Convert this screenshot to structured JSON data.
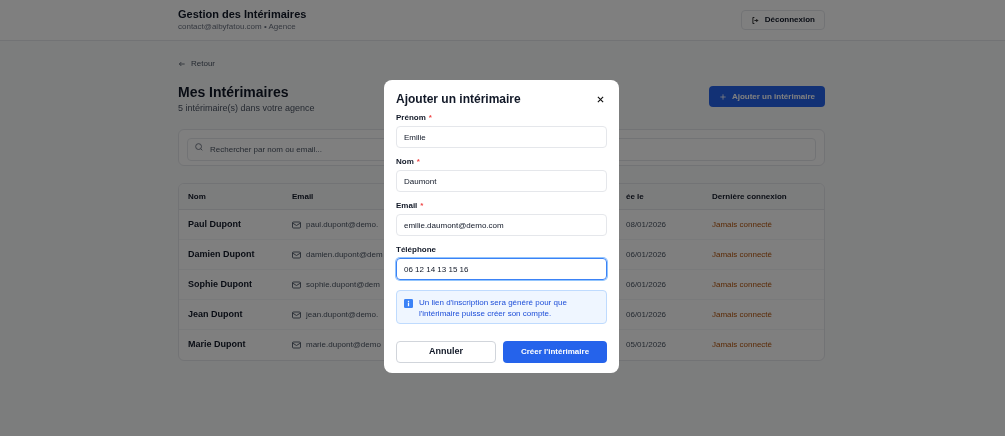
{
  "header": {
    "title": "Gestion des Intérimaires",
    "subtitle": "contact@aibyfatou.com • Agence",
    "logout": "Déconnexion"
  },
  "back": "Retour",
  "page": {
    "title": "Mes Intérimaires",
    "subtitle": "5 intérimaire(s) dans votre agence",
    "add_button": "Ajouter un intérimaire"
  },
  "search": {
    "placeholder": "Rechercher par nom ou email..."
  },
  "table": {
    "columns": [
      "Nom",
      "Email",
      "ée le",
      "Dernière connexion"
    ],
    "rows": [
      {
        "name": "Paul Dupont",
        "email": "paul.dupont@demo.",
        "date": "08/01/2026",
        "last": "Jamais connecté"
      },
      {
        "name": "Damien Dupont",
        "email": "damien.dupont@dem",
        "date": "06/01/2026",
        "last": "Jamais connecté"
      },
      {
        "name": "Sophie Dupont",
        "email": "sophie.dupont@dem",
        "date": "06/01/2026",
        "last": "Jamais connecté"
      },
      {
        "name": "Jean Dupont",
        "email": "jean.dupont@demo.",
        "date": "06/01/2026",
        "last": "Jamais connecté"
      },
      {
        "name": "Marie Dupont",
        "email": "marie.dupont@demo",
        "date": "05/01/2026",
        "last": "Jamais connecté"
      }
    ]
  },
  "dialog": {
    "title": "Ajouter un intérimaire",
    "required_mark": "*",
    "fields": [
      {
        "label": "Prénom",
        "required": true,
        "value": "Emilie",
        "focused": false
      },
      {
        "label": "Nom",
        "required": true,
        "value": "Daumont",
        "focused": false
      },
      {
        "label": "Email",
        "required": true,
        "value": "emilie.daumont@demo.com",
        "focused": false
      },
      {
        "label": "Téléphone",
        "required": false,
        "value": "06 12 14 13 15 16",
        "focused": true
      }
    ],
    "info": "Un lien d'inscription sera généré pour que l'intérimaire puisse créer son compte.",
    "cancel": "Annuler",
    "submit": "Créer l'intérimaire"
  }
}
